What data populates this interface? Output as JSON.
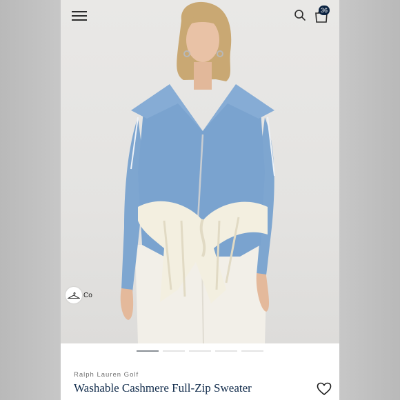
{
  "header": {
    "menu_icon": "hamburger-menu-icon",
    "search_icon": "search-icon",
    "bag_icon": "shopping-bag-icon",
    "bag_count": "36"
  },
  "hero": {
    "closet_label": "Co",
    "closet_icon": "hanger-icon",
    "carousel_total": 5,
    "carousel_active": 1,
    "colors": {
      "sweater": "#7aa3cf",
      "knit": "#f3efe0",
      "trousers": "#f4f1ea"
    }
  },
  "product": {
    "brand": "Ralph Lauren Golf",
    "title": "Washable Cashmere Full-Zip Sweater",
    "favorite_icon": "heart-icon"
  },
  "colors": {
    "title": "#0f2a4a",
    "badge": "#0a2240"
  }
}
